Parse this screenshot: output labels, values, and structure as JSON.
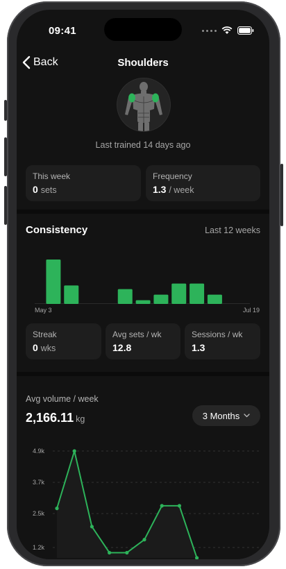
{
  "status": {
    "time": "09:41"
  },
  "nav": {
    "back_label": "Back",
    "title": "Shoulders"
  },
  "last_trained": "Last trained 14 days ago",
  "summary": {
    "this_week": {
      "label": "This week",
      "value": "0",
      "unit": "sets"
    },
    "frequency": {
      "label": "Frequency",
      "value": "1.3",
      "unit": "/ week"
    }
  },
  "consistency": {
    "title": "Consistency",
    "range": "Last 12 weeks",
    "start_label": "May 3",
    "end_label": "Jul 19"
  },
  "stats": {
    "streak": {
      "label": "Streak",
      "value": "0",
      "unit": "wks"
    },
    "avg_sets": {
      "label": "Avg sets / wk",
      "value": "12.8"
    },
    "sessions": {
      "label": "Sessions / wk",
      "value": "1.3"
    }
  },
  "volume": {
    "label": "Avg volume / week",
    "value": "2,166.11",
    "unit": "kg",
    "range_button": "3 Months"
  },
  "colors": {
    "accent": "#2db35a",
    "background": "#131313",
    "card": "#1e1e1e"
  },
  "chart_data": [
    {
      "type": "bar",
      "categories": [
        "1",
        "2",
        "3",
        "4",
        "5",
        "6",
        "7",
        "8",
        "9",
        "10",
        "11",
        "12"
      ],
      "values": [
        24,
        10,
        0,
        0,
        8,
        2,
        5,
        11,
        11,
        5,
        0,
        0
      ],
      "xlabel": "",
      "ylabel": "",
      "ticks": [
        "May 3",
        "Jul 19"
      ],
      "grid": false
    },
    {
      "type": "line",
      "x": [
        1,
        2,
        3,
        4,
        5,
        6,
        7,
        8,
        9
      ],
      "y": [
        2700,
        4900,
        2000,
        1000,
        1000,
        1500,
        2800,
        2800,
        800
      ],
      "yticks": [
        "4.9k",
        "3.7k",
        "2.5k",
        "1.2k"
      ],
      "ytick_values": [
        4900,
        3700,
        2500,
        1200
      ],
      "ylim": [
        800,
        4900
      ],
      "grid": true,
      "color": "#2db35a"
    }
  ]
}
